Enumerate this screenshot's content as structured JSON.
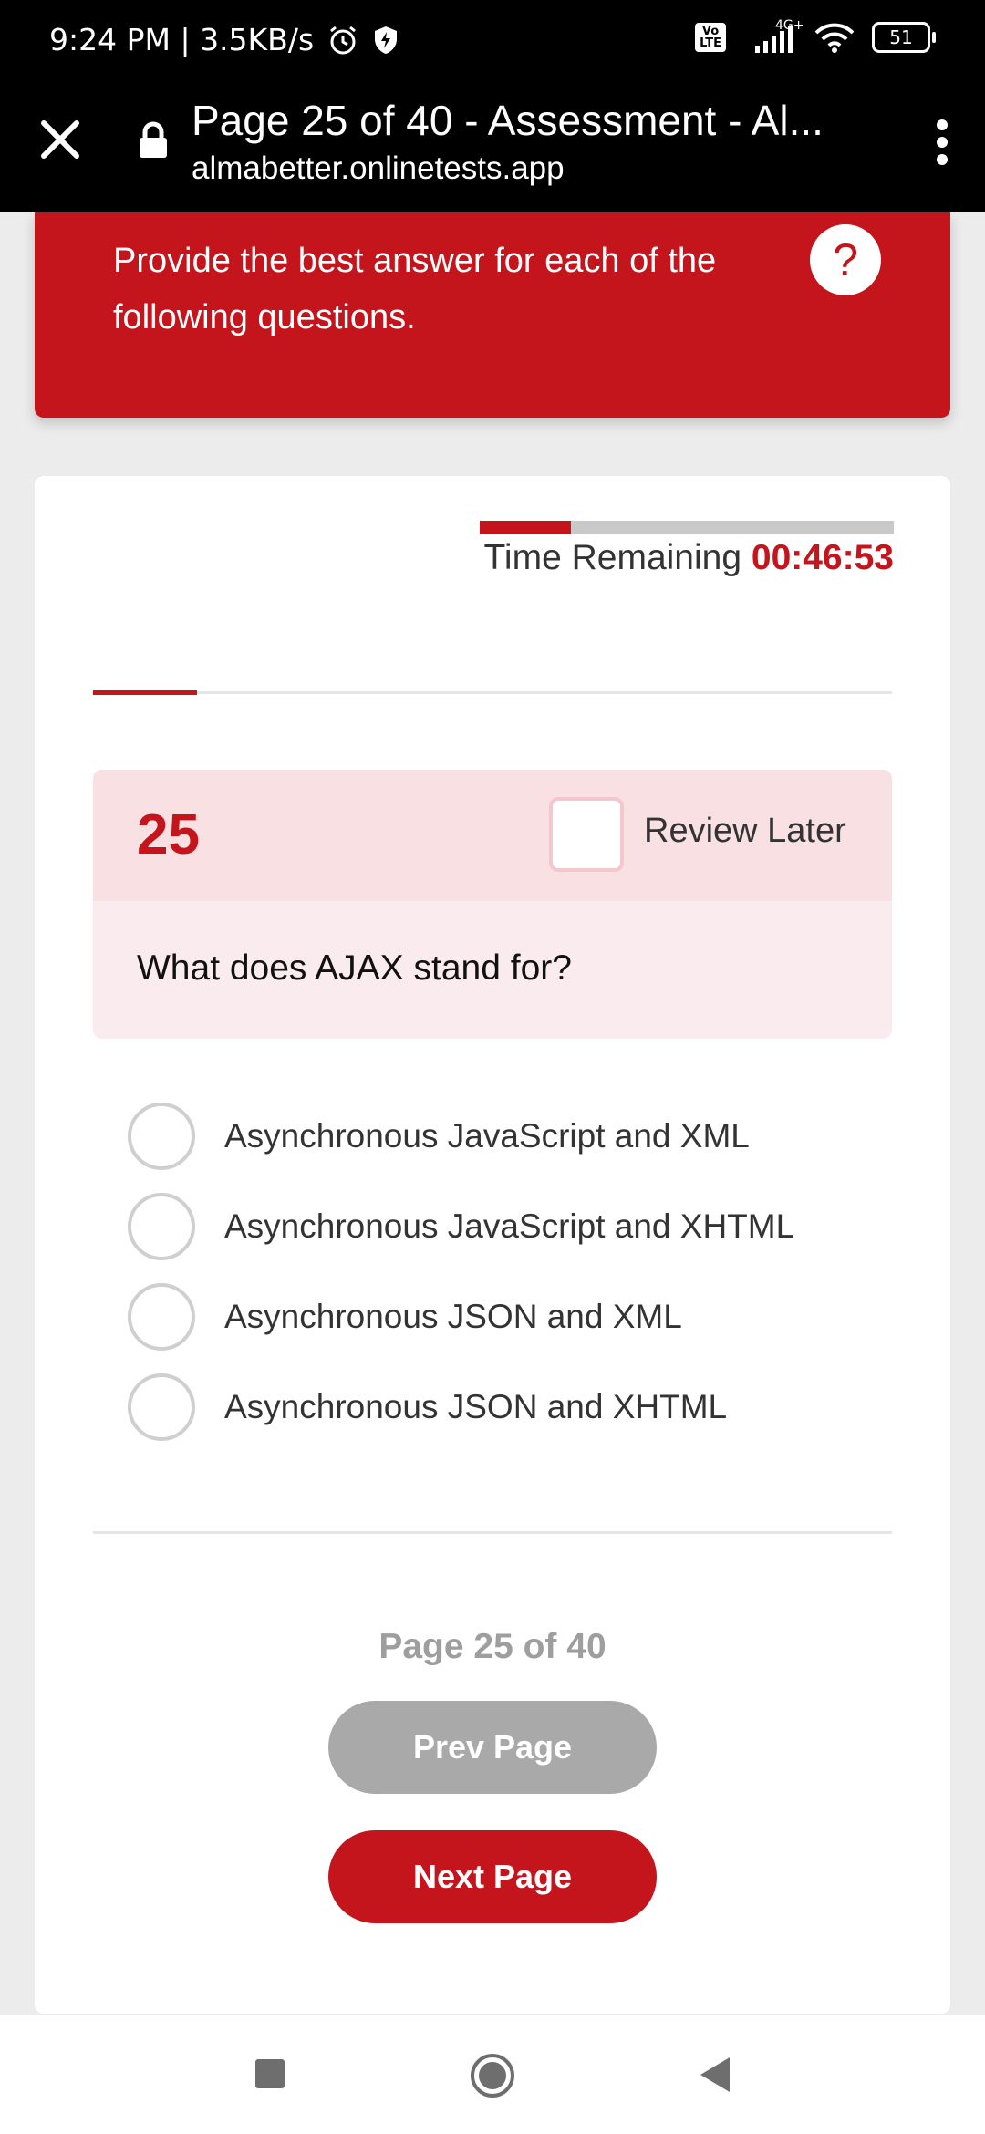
{
  "status_bar": {
    "time_speed": "9:24 PM | 3.5KB/s",
    "volte": "Vo\nLTE",
    "network": "4G+",
    "battery": "51"
  },
  "browser": {
    "title": "Page 25 of 40 - Assessment - Al...",
    "url": "almabetter.onlinetests.app"
  },
  "banner": {
    "instruction": "Provide the best answer for each of the following questions.",
    "help_symbol": "?"
  },
  "timer": {
    "label": "Time Remaining",
    "value": "00:46:53",
    "progress_fraction": 0.22
  },
  "assessment_progress_fraction": 0.13,
  "question": {
    "number": "25",
    "review_label": "Review Later",
    "text": "What does AJAX stand for?",
    "options": [
      "Asynchronous JavaScript and XML",
      "Asynchronous JavaScript and XHTML",
      "Asynchronous JSON and XML",
      "Asynchronous JSON and XHTML"
    ]
  },
  "pagination": {
    "indicator": "Page 25 of 40",
    "prev_label": "Prev Page",
    "next_label": "Next Page"
  },
  "colors": {
    "accent": "#c4151c",
    "question_header": "#f8e0e3",
    "question_body": "#faecee",
    "disabled_button": "#a9a9a9"
  }
}
